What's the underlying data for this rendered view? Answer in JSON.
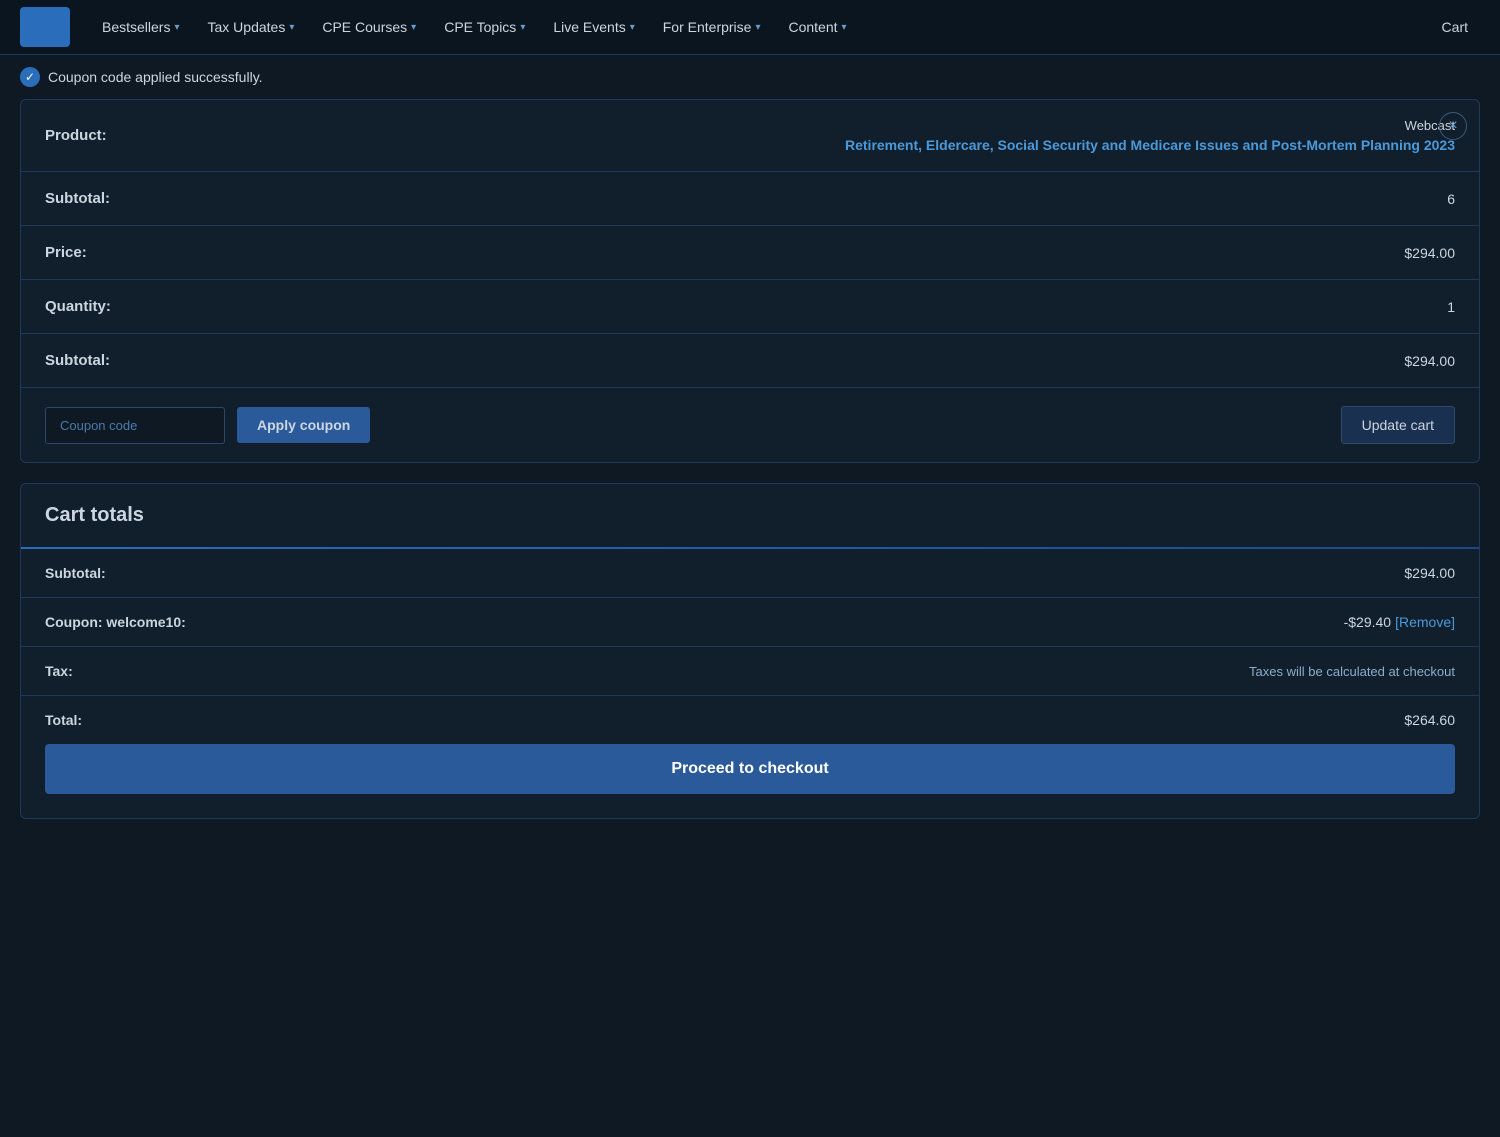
{
  "navbar": {
    "items": [
      {
        "id": "bestsellers",
        "label": "Bestsellers",
        "has_dropdown": true
      },
      {
        "id": "tax-updates",
        "label": "Tax Updates",
        "has_dropdown": true
      },
      {
        "id": "cpe-courses",
        "label": "CPE Courses",
        "has_dropdown": true
      },
      {
        "id": "cpe-topics",
        "label": "CPE Topics",
        "has_dropdown": true
      },
      {
        "id": "live-events",
        "label": "Live Events",
        "has_dropdown": true
      },
      {
        "id": "for-enterprise",
        "label": "For Enterprise",
        "has_dropdown": true
      },
      {
        "id": "content",
        "label": "Content",
        "has_dropdown": true
      }
    ],
    "cart_label": "Cart"
  },
  "coupon_banner": {
    "message": "Coupon code applied successfully."
  },
  "cart": {
    "close_label": "×",
    "product_label": "Product:",
    "product_type": "Webcast",
    "product_name": "Retirement, Eldercare, Social Security and Medicare Issues and Post-Mortem Planning 2023",
    "subtotal_label": "Subtotal:",
    "subtotal_short": "6",
    "price_label": "Price:",
    "price_value": "$294.00",
    "quantity_label": "Quantity:",
    "quantity_value": "1",
    "subtotal2_label": "Subtotal:",
    "subtotal2_value": "$294.00",
    "coupon_placeholder": "Coupon code",
    "apply_coupon_label": "Apply coupon",
    "update_cart_label": "Update cart"
  },
  "cart_totals": {
    "heading": "Cart totals",
    "subtotal_label": "Subtotal:",
    "subtotal_value": "$294.00",
    "coupon_label": "Coupon: welcome10:",
    "coupon_discount": "-$29.40",
    "remove_label": "[Remove]",
    "tax_label": "Tax:",
    "tax_note": "Taxes will be calculated at checkout",
    "total_label": "Total:",
    "total_value": "$264.60",
    "proceed_label": "Proceed to checkout"
  }
}
